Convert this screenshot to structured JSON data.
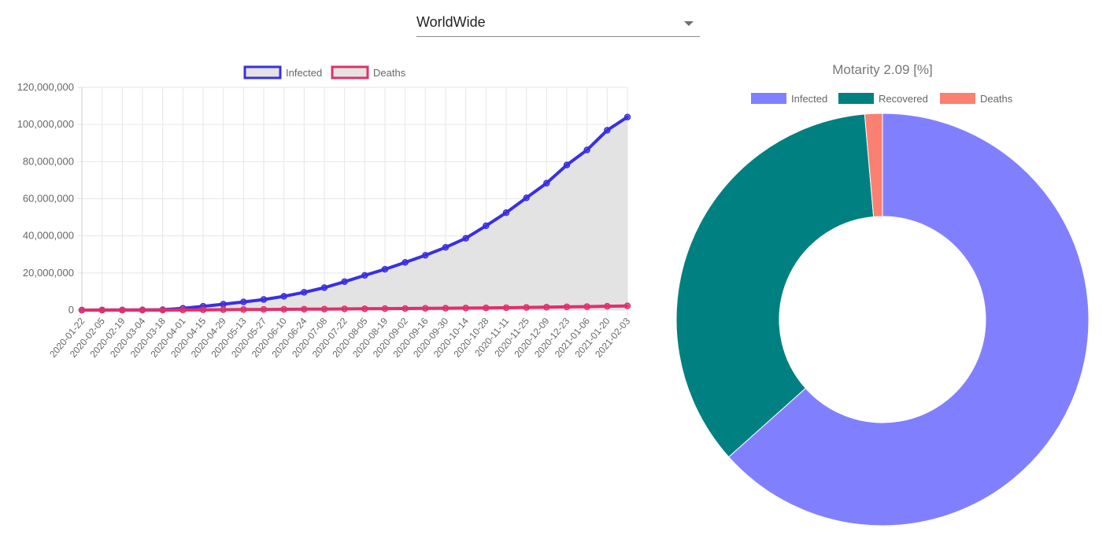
{
  "selector": {
    "value": "WorldWide",
    "icon": "chevron-down-icon"
  },
  "colors": {
    "infected_line": "#3b2fe0",
    "infected_fill": "#e3e3e3",
    "deaths_line": "#e0306a",
    "donut_infected": "#8080ff",
    "donut_recovered": "#008080",
    "donut_deaths": "#fa8072",
    "grid": "#e6e6e6",
    "axis_text": "#666666"
  },
  "chart_data": [
    {
      "type": "line",
      "legend": [
        "Infected",
        "Deaths"
      ],
      "legend_placement": "top",
      "grid": true,
      "ylim": [
        0,
        120000000
      ],
      "yticks": [
        "0",
        "20,000,000",
        "40,000,000",
        "60,000,000",
        "80,000,000",
        "100,000,000",
        "120,000,000"
      ],
      "xtick_labels": [
        "2020-01-22",
        "2020-02-05",
        "2020-02-19",
        "2020-03-04",
        "2020-03-18",
        "2020-04-01",
        "2020-04-15",
        "2020-04-29",
        "2020-05-13",
        "2020-05-27",
        "2020-06-10",
        "2020-06-24",
        "2020-07-08",
        "2020-07-22",
        "2020-08-05",
        "2020-08-19",
        "2020-09-02",
        "2020-09-16",
        "2020-09-30",
        "2020-10-14",
        "2020-10-28",
        "2020-11-11",
        "2020-11-25",
        "2020-12-09",
        "2020-12-23",
        "2021-01-06",
        "2021-01-20",
        "2021-02-03"
      ],
      "x": [
        "2020-01-22",
        "2020-02-05",
        "2020-02-19",
        "2020-03-04",
        "2020-03-18",
        "2020-04-01",
        "2020-04-15",
        "2020-04-29",
        "2020-05-13",
        "2020-05-27",
        "2020-06-10",
        "2020-06-24",
        "2020-07-08",
        "2020-07-22",
        "2020-08-05",
        "2020-08-19",
        "2020-09-02",
        "2020-09-16",
        "2020-09-30",
        "2020-10-14",
        "2020-10-28",
        "2020-11-11",
        "2020-11-25",
        "2020-12-09",
        "2020-12-23",
        "2021-01-06",
        "2021-01-20",
        "2021-02-03"
      ],
      "series": [
        {
          "name": "Infected",
          "values": [
            560,
            28000,
            75000,
            95000,
            220000,
            930000,
            2050000,
            3200000,
            4400000,
            5700000,
            7400000,
            9600000,
            12100000,
            15300000,
            18700000,
            22000000,
            25700000,
            29500000,
            33800000,
            38700000,
            45400000,
            52500000,
            60500000,
            68400000,
            78200000,
            86300000,
            96900000,
            104000000
          ]
        },
        {
          "name": "Deaths",
          "values": [
            17,
            560,
            2100,
            3300,
            9000,
            47000,
            135000,
            230000,
            300000,
            360000,
            420000,
            490000,
            550000,
            630000,
            710000,
            790000,
            860000,
            930000,
            1010000,
            1090000,
            1180000,
            1290000,
            1430000,
            1580000,
            1730000,
            1880000,
            2070000,
            2260000
          ]
        }
      ]
    },
    {
      "type": "pie",
      "title": "Motarity 2.09 [%]",
      "legend_placement": "top",
      "categories": [
        "Infected",
        "Recovered",
        "Deaths"
      ],
      "values": [
        104000000,
        57800000,
        2260000
      ]
    }
  ]
}
